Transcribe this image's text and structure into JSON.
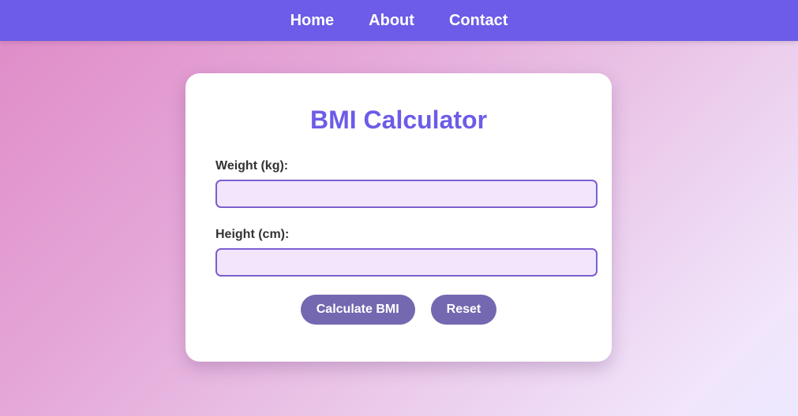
{
  "nav": {
    "items": [
      {
        "label": "Home"
      },
      {
        "label": "About"
      },
      {
        "label": "Contact"
      }
    ]
  },
  "form": {
    "title": "BMI Calculator",
    "weight": {
      "label": "Weight (kg):",
      "value": "",
      "placeholder": ""
    },
    "height": {
      "label": "Height (cm):",
      "value": "",
      "placeholder": ""
    },
    "calculate_label": "Calculate BMI",
    "reset_label": "Reset"
  },
  "colors": {
    "nav_background": "#6c5ce7",
    "title": "#6c5ce7",
    "input_border": "#7b5fd0",
    "input_background": "#f1e6fb",
    "button_background": "#7468b0",
    "page_gradient_start": "#df8ac6",
    "page_gradient_end": "#ece8ff"
  }
}
